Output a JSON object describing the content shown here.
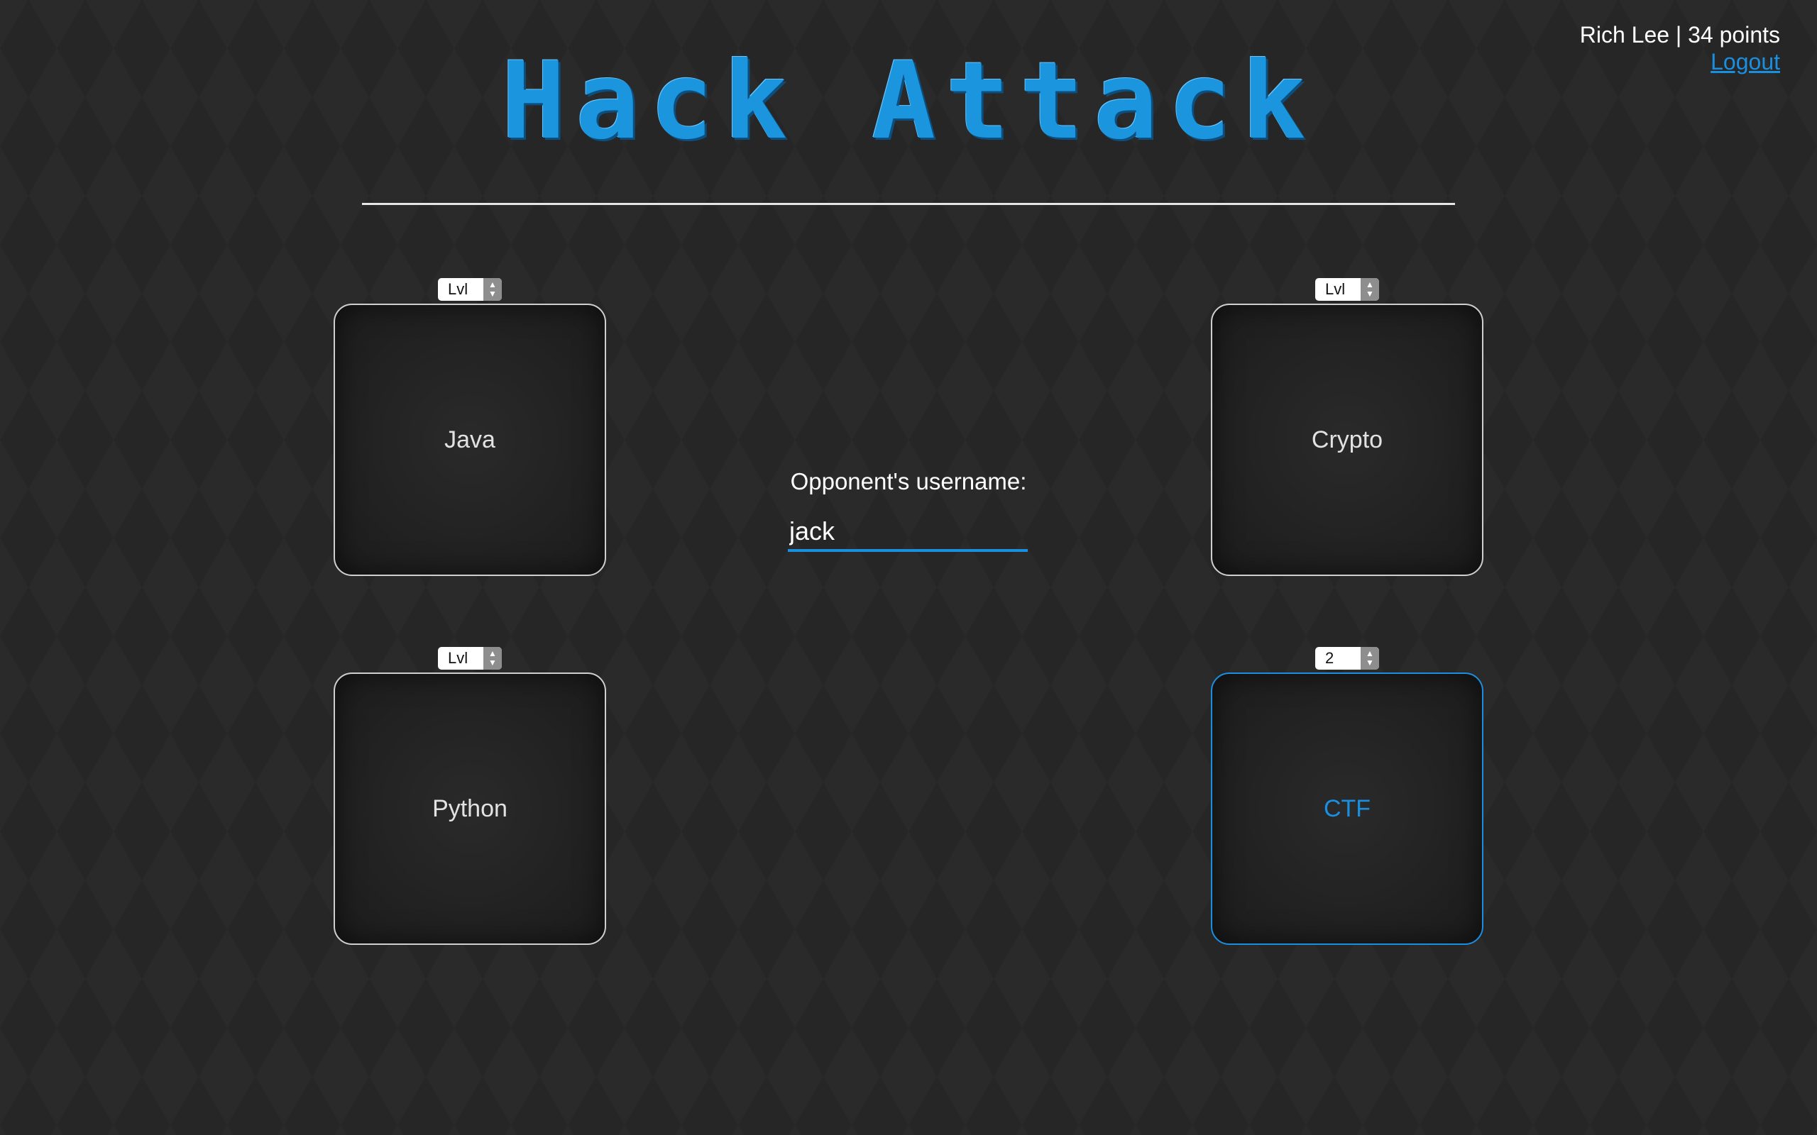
{
  "header": {
    "user": "Rich Lee | 34 points",
    "logout_label": "Logout",
    "title": "Hack Attack"
  },
  "tiles": [
    {
      "label": "Java",
      "level": "Lvl",
      "selected": false
    },
    {
      "label": "Crypto",
      "level": "Lvl",
      "selected": false
    },
    {
      "label": "Python",
      "level": "Lvl",
      "selected": false
    },
    {
      "label": "CTF",
      "level": "2",
      "selected": true
    }
  ],
  "opponent": {
    "label": "Opponent's username:",
    "value": "jack"
  },
  "colors": {
    "accent": "#1a8fe0",
    "background": "#262626",
    "tile_border": "#cfcfcf"
  },
  "icons": {
    "spinner": "up-down-arrows-icon"
  }
}
